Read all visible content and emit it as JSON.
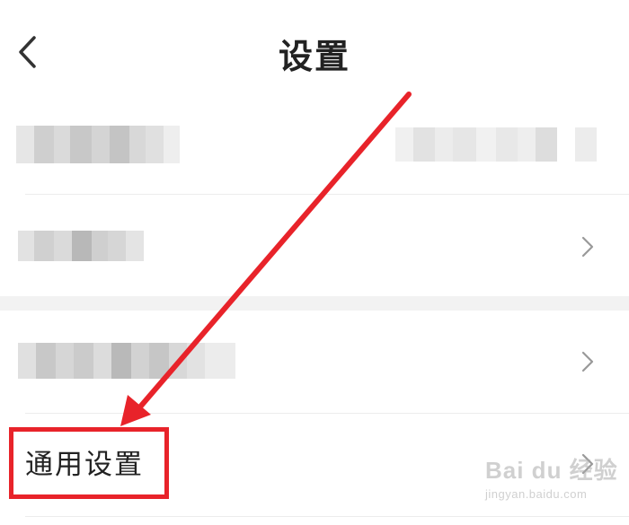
{
  "header": {
    "title": "设置",
    "back_icon": "chevron-left-icon"
  },
  "rows": [
    {
      "id": "account",
      "label_blurred": true,
      "value_blurred": true
    },
    {
      "id": "item-2",
      "label_blurred": true,
      "chevron": "chevron-right-icon"
    },
    {
      "id": "item-3",
      "label_blurred": true,
      "chevron": "chevron-right-icon"
    },
    {
      "id": "general",
      "label": "通用设置",
      "chevron": "chevron-right-icon"
    }
  ],
  "annotation": {
    "color": "#e8232a"
  },
  "watermark": {
    "brand": "Bai du 经验",
    "url": "jingyan.baidu.com"
  }
}
